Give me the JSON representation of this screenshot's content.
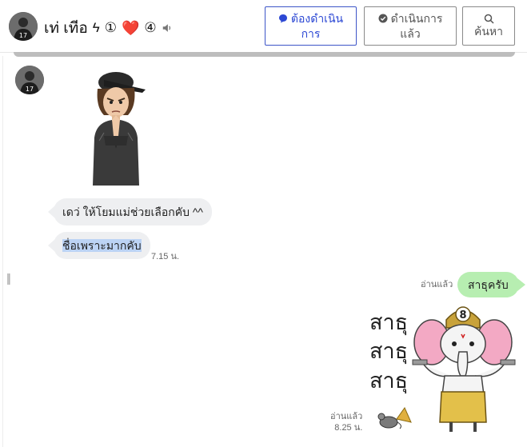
{
  "header": {
    "contact_name": "เท่ เทีอ",
    "name_glyphs": [
      "ϟ",
      "①",
      "❤️",
      "④"
    ],
    "icons": {
      "mute": "speaker-icon",
      "todo": "chat-bubble-icon",
      "done": "check-circle-icon",
      "search": "search-icon"
    },
    "buttons": {
      "todo_line1": "ต้องดำเนิน",
      "todo_line2": "การ",
      "done_line1": "ดำเนินการ",
      "done_line2": "แล้ว",
      "search_label": "ค้นหา"
    },
    "accent_color": "#2c48d4"
  },
  "messages": {
    "incoming_1": "เดว่ ให้โยมแม่ช่วยเลือกคับ ^^",
    "incoming_2": "ชื่อเพราะมากคับ",
    "incoming_2_time": "7.15 น.",
    "outgoing_read": "อ่านแล้ว",
    "outgoing_1": "สาธุครับ",
    "sticker_text": [
      "สาธุ",
      "สาธุ",
      "สาธุ"
    ],
    "sticker_badge": "8",
    "sticker_read": "อ่านแล้ว",
    "sticker_time": "8.25 น.",
    "outgoing_bubble_color": "#b7eeb1",
    "incoming_bubble_color": "#eeeff1"
  }
}
